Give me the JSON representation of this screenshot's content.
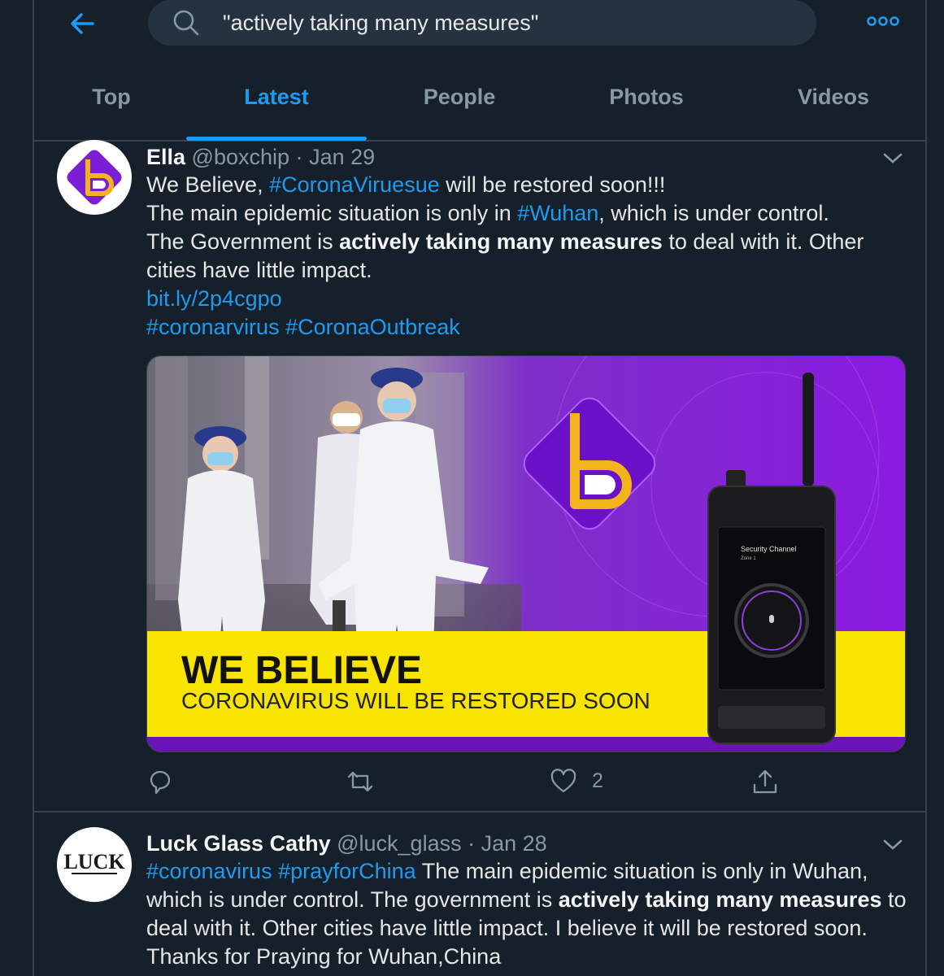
{
  "search": {
    "query": "\"actively taking many measures\""
  },
  "tabs": [
    {
      "label": "Top"
    },
    {
      "label": "Latest"
    },
    {
      "label": "People"
    },
    {
      "label": "Photos"
    },
    {
      "label": "Videos"
    }
  ],
  "active_tab": "Latest",
  "tweets": [
    {
      "name": "Ella",
      "handle": "@boxchip",
      "dot": "·",
      "date": "Jan 29",
      "lines": {
        "l1_a": "We Believe, ",
        "l1_tag": "#CoronaViruesue",
        "l1_b": " will be restored soon!!!",
        "l2_a": "The main epidemic situation is only in ",
        "l2_tag": "#Wuhan",
        "l2_b": ", which is under control.",
        "l3_a": "The Government is ",
        "l3_bold": "actively taking many measures",
        "l3_b": " to deal with it. Other cities have little impact.",
        "link": "bit.ly/2p4cgpo",
        "tags_a": "#coronarvirus",
        "tags_b": "#CoronaOutbreak"
      },
      "media": {
        "headline": "WE BELIEVE",
        "subline": "CORONAVIRUS WILL BE RESTORED SOON",
        "device_screen_label": "Security Channel",
        "device_zone": "Zone 1"
      },
      "like_count": "2"
    },
    {
      "name": "Luck Glass Cathy",
      "handle": "@luck_glass",
      "dot": "·",
      "date": "Jan 28",
      "avatar_text": "LUCK",
      "lines": {
        "tag1": "#coronavirus",
        "tag2": "#prayforChina",
        "t1": " The main epidemic situation is only in Wuhan, which is under control. The government is ",
        "bold": "actively taking many measures",
        "t2": " to deal with it. Other cities have little impact. I believe it will be restored soon. Thanks for Praying for Wuhan,China"
      }
    }
  ],
  "colors": {
    "accent": "#1d9bf0",
    "background": "#15202b",
    "muted": "#8899a6",
    "border": "#38444d",
    "banner_yellow": "#f7e400",
    "banner_purple": "#8a1be0"
  },
  "icons": [
    "back-arrow-icon",
    "search-icon",
    "more-icon",
    "chevron-down-icon",
    "reply-icon",
    "retweet-icon",
    "heart-icon",
    "share-icon"
  ]
}
